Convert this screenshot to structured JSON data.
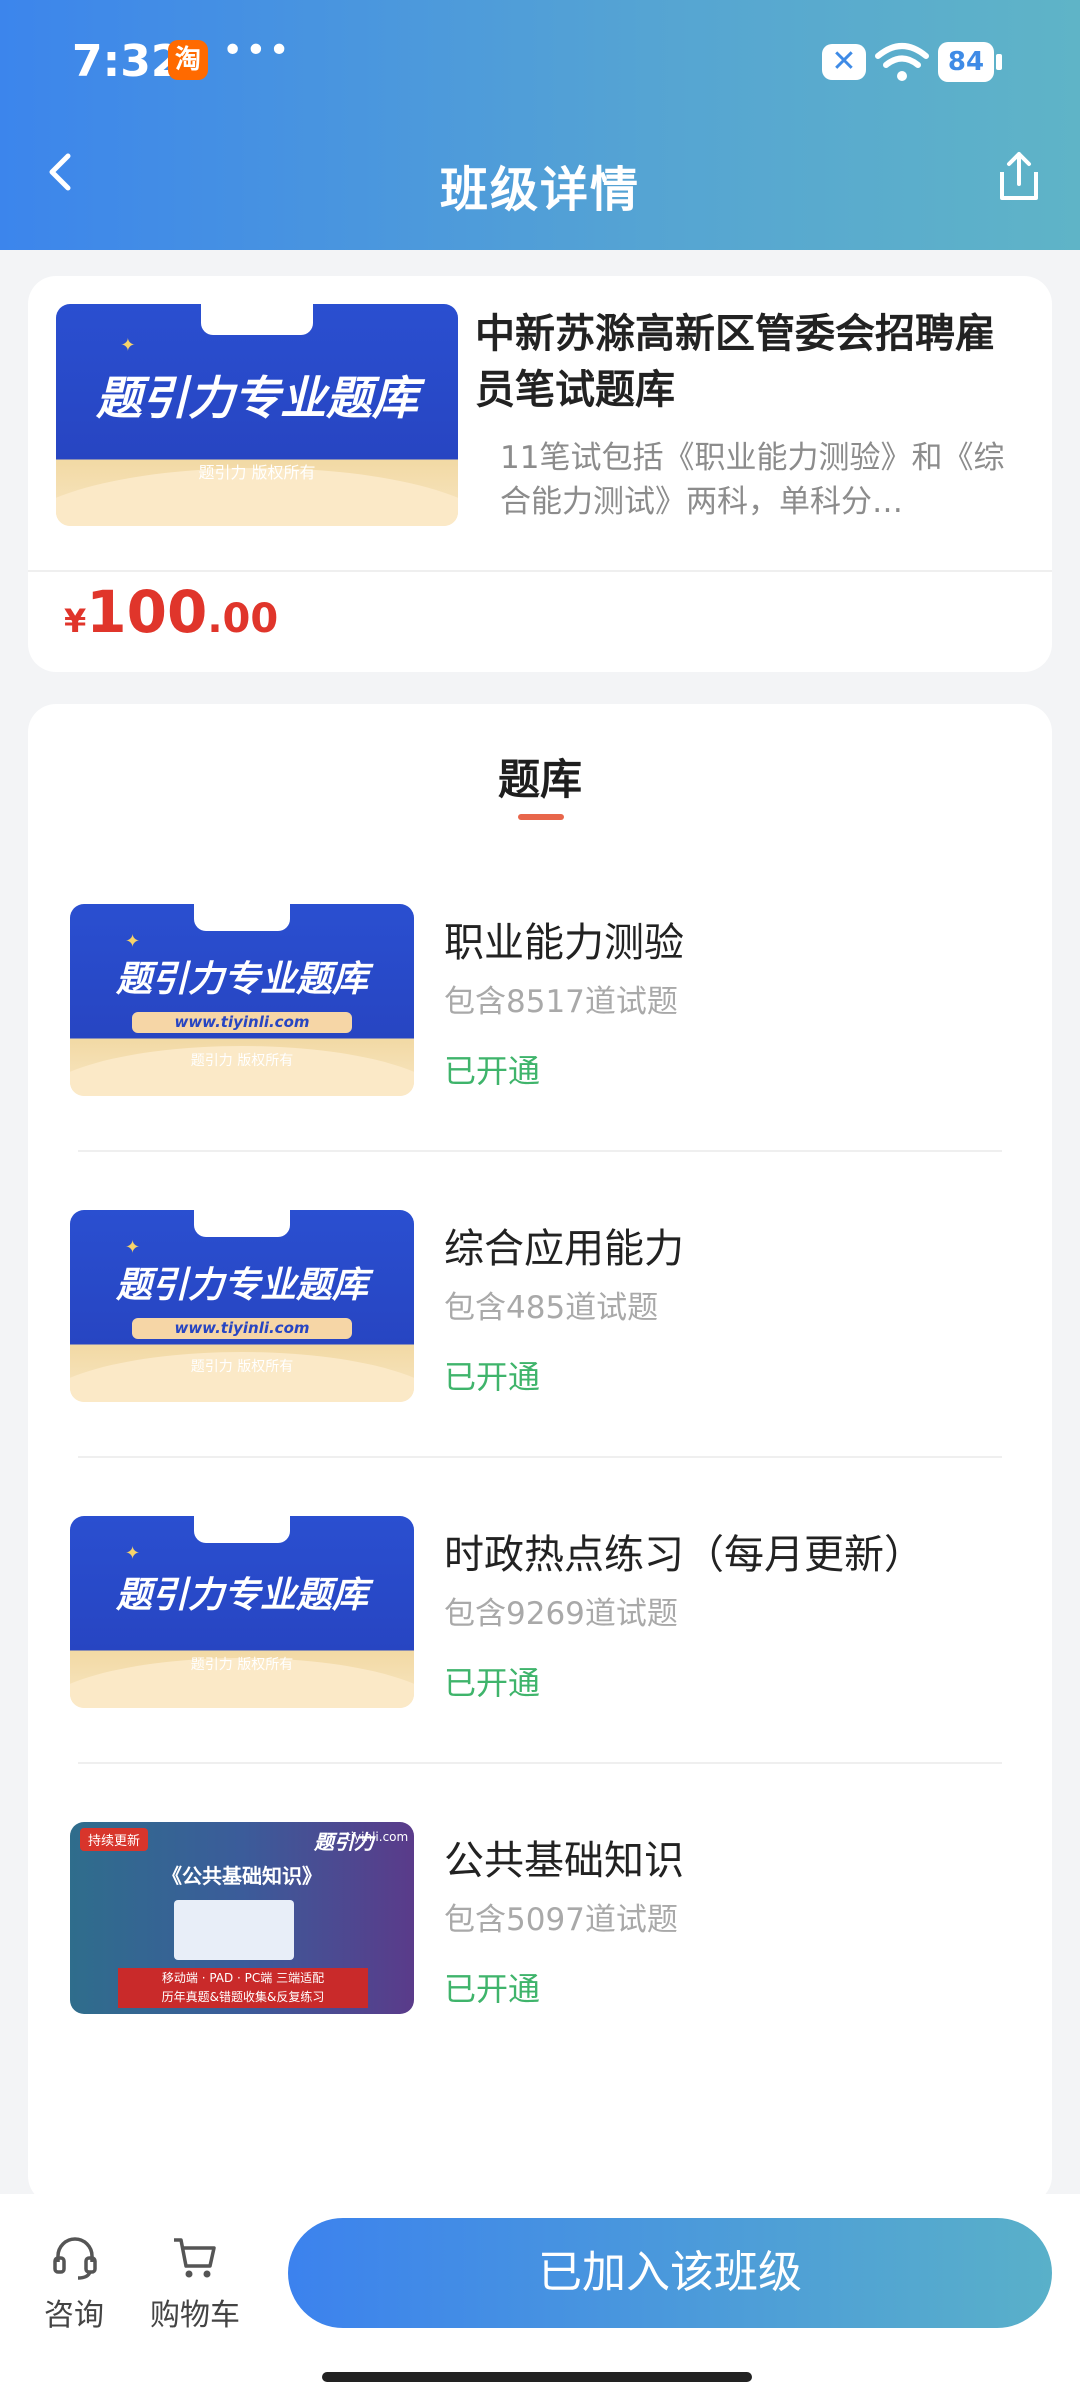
{
  "status_bar": {
    "time": "7:32",
    "taobao_label": "淘",
    "dots": "•••",
    "battery": "84"
  },
  "nav": {
    "title": "班级详情"
  },
  "class_card": {
    "cover_title": "题引力专业题库",
    "cover_sub": "题引力 版权所有",
    "title": "中新苏滁高新区管委会招聘雇员笔试题库",
    "description": "11笔试包括《职业能力测验》和《综合能力测试》两科，单科分…",
    "price_currency": "¥",
    "price_int": "100",
    "price_dec": ".00"
  },
  "bank_section": {
    "heading": "题库",
    "items": [
      {
        "title": "职业能力测验",
        "count": "包含8517道试题",
        "status": "已开通",
        "cover_title": "题引力专业题库",
        "cover_url": "www.tiyinli.com",
        "cover_sub": "题引力 版权所有"
      },
      {
        "title": "综合应用能力",
        "count": "包含485道试题",
        "status": "已开通",
        "cover_title": "题引力专业题库",
        "cover_url": "www.tiyinli.com",
        "cover_sub": "题引力 版权所有"
      },
      {
        "title": "时政热点练习（每月更新）",
        "count": "包含9269道试题",
        "status": "已开通",
        "cover_title": "题引力专业题库",
        "cover_sub": "题引力 版权所有"
      },
      {
        "title": "公共基础知识",
        "count": "包含5097道试题",
        "status": "已开通",
        "cover_badge": "持续更新",
        "cover_title": "《公共基础知识》",
        "cover_brand": "题引力",
        "cover_site": "tiyinli.com",
        "cover_banner_1": "移动端 · PAD · PC端 三端适配",
        "cover_banner_2": "历年真题&错题收集&反复练习"
      }
    ]
  },
  "bottom_bar": {
    "consult_label": "咨询",
    "cart_label": "购物车",
    "join_label": "已加入该班级"
  },
  "colors": {
    "accent": "#3c85ec",
    "price": "#e0352b",
    "status": "#3fb46b"
  }
}
